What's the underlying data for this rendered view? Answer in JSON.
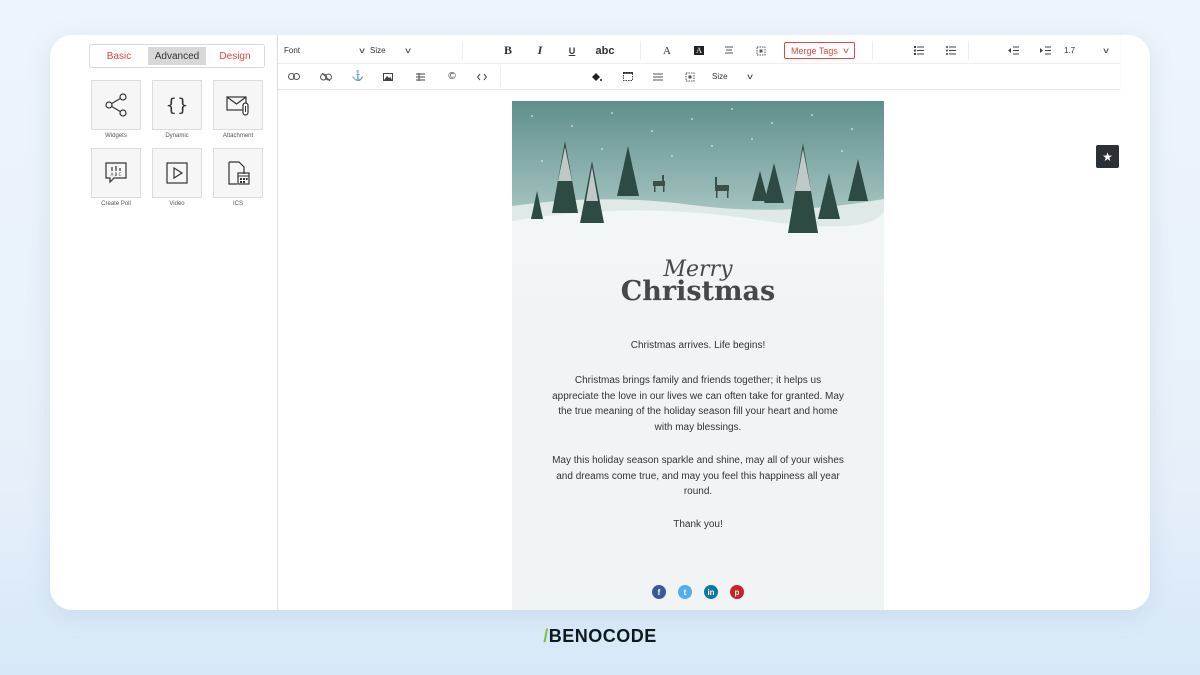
{
  "left_panel": {
    "tabs": [
      {
        "label": "Basic",
        "active": false
      },
      {
        "label": "Advanced",
        "active": true
      },
      {
        "label": "Design",
        "active": false
      }
    ],
    "widgets": [
      {
        "label": "Widgets",
        "icon": "share-icon"
      },
      {
        "label": "Dynamic",
        "icon": "braces-icon"
      },
      {
        "label": "Attachment",
        "icon": "attachment-icon"
      },
      {
        "label": "Create Poll",
        "icon": "poll-icon"
      },
      {
        "label": "Video",
        "icon": "play-icon"
      },
      {
        "label": "ICS",
        "icon": "calendar-file-icon"
      }
    ]
  },
  "toolbar": {
    "font_label": "Font",
    "size_label": "Size",
    "bold": "B",
    "italic": "I",
    "underline": "U",
    "strike": "abc",
    "font_color": "A",
    "bg_color": "A",
    "merge_tags": "Merge Tags",
    "line_height": "1.7",
    "size2_label": "Size"
  },
  "email": {
    "merry": "Merry",
    "christmas": "Christmas",
    "p1": "Christmas arrives.  Life begins!",
    "p2": "Christmas brings family and friends together; it helps us appreciate the love in our lives we can often take for granted.  May the true meaning of the holiday season fill your heart and home with may blessings.",
    "p3": "May this holiday season sparkle and shine, may all of your wishes and dreams come true, and may you feel this happiness all year round.",
    "p4": "Thank you!",
    "social": [
      {
        "icon": "facebook-icon",
        "glyph": "f",
        "color": "#3b5998"
      },
      {
        "icon": "twitter-icon",
        "glyph": "t",
        "color": "#55acee"
      },
      {
        "icon": "linkedin-icon",
        "glyph": "in",
        "color": "#0e76a8"
      },
      {
        "icon": "pinterest-icon",
        "glyph": "p",
        "color": "#cb2027"
      }
    ]
  },
  "brand": {
    "name": "BENOCODE",
    "accent_color": "#7cc63e"
  },
  "colors": {
    "accent": "#e0473d",
    "dark_button": "#2b2f36"
  }
}
